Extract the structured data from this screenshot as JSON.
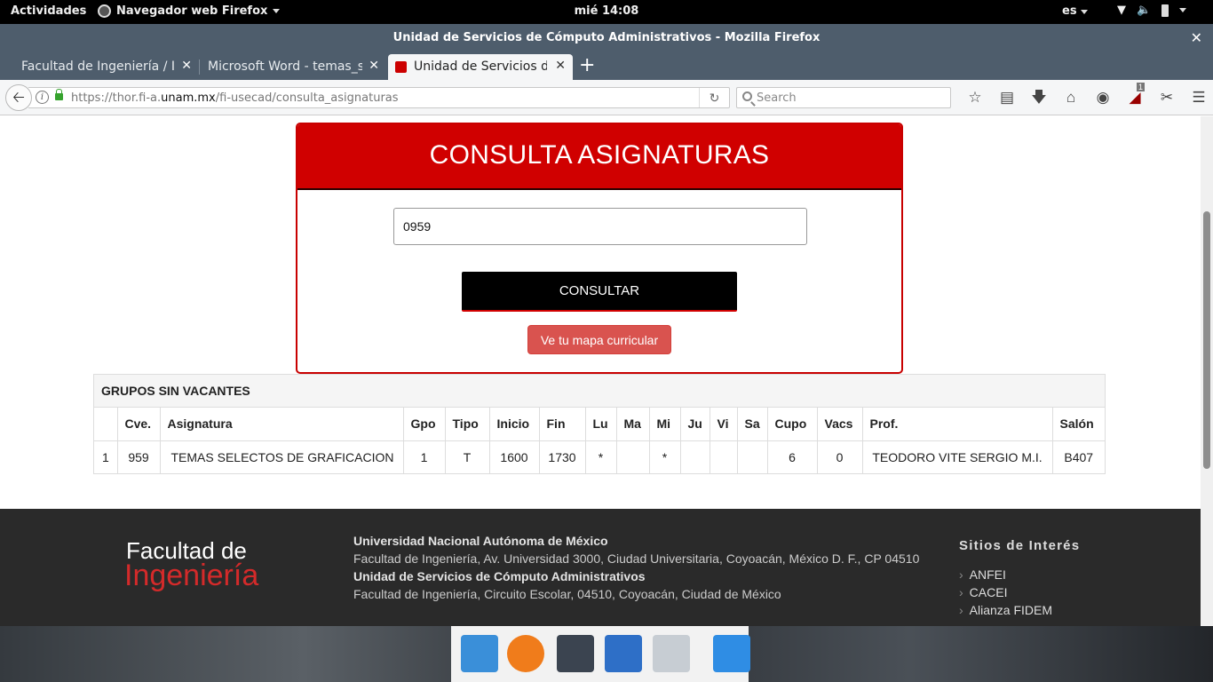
{
  "topbar": {
    "activities": "Actividades",
    "app_menu": "Navegador web Firefox",
    "clock": "mié 14:08",
    "lang": "es"
  },
  "window": {
    "title": "Unidad de Servicios de Cómputo Administrativos - Mozilla Firefox"
  },
  "tabs": [
    {
      "label": "Facultad de Ingeniería / Ingeniería"
    },
    {
      "label": "Microsoft Word - temas_selectos"
    },
    {
      "label": "Unidad de Servicios de Cómputo"
    }
  ],
  "navbar": {
    "url_prefix": "https://thor.fi-a.",
    "url_domain": "unam.mx",
    "url_path": "/fi-usecad/consulta_asignaturas",
    "search_placeholder": "Search",
    "ublock_badge": "1"
  },
  "consulta": {
    "title": "CONSULTA ASIGNATURAS",
    "input_value": "0959",
    "submit_label": "CONSULTAR",
    "mapa_label": "Ve tu mapa curricular"
  },
  "grupos": {
    "heading": "GRUPOS SIN VACANTES",
    "columns": [
      "",
      "Cve.",
      "Asignatura",
      "Gpo",
      "Tipo",
      "Inicio",
      "Fin",
      "Lu",
      "Ma",
      "Mi",
      "Ju",
      "Vi",
      "Sa",
      "Cupo",
      "Vacs",
      "Prof.",
      "Salón"
    ],
    "rows": [
      [
        "1",
        "959",
        "TEMAS SELECTOS DE GRAFICACION",
        "1",
        "T",
        "1600",
        "1730",
        "*",
        "",
        "*",
        "",
        "",
        "",
        "6",
        "0",
        "TEODORO VITE SERGIO M.I.",
        "B407"
      ]
    ]
  },
  "footer": {
    "logo_line1": "Facultad de",
    "logo_line2": "Ingeniería",
    "unam_name": "Universidad Nacional Autónoma de México",
    "unam_address": "Facultad de Ingeniería, Av. Universidad 3000, Ciudad Universitaria, Coyoacán, México D. F., CP 04510",
    "unit_name": "Unidad de Servicios de Cómputo Administrativos",
    "unit_address": "Facultad de Ingeniería, Circuito Escolar, 04510, Coyoacán, Ciudad de México",
    "sites_title": "Sitios de Interés",
    "sites": [
      "ANFEI",
      "CACEI",
      "Alianza FIDEM"
    ]
  },
  "colors": {
    "accent_red": "#d00000",
    "footer_bg": "#2a2a2a",
    "button_danger": "#d9534f"
  },
  "icons": [
    "ship-icon",
    "firefox-icon",
    "terminal-icon",
    "chat-icon",
    "files-icon",
    "window-icon"
  ]
}
